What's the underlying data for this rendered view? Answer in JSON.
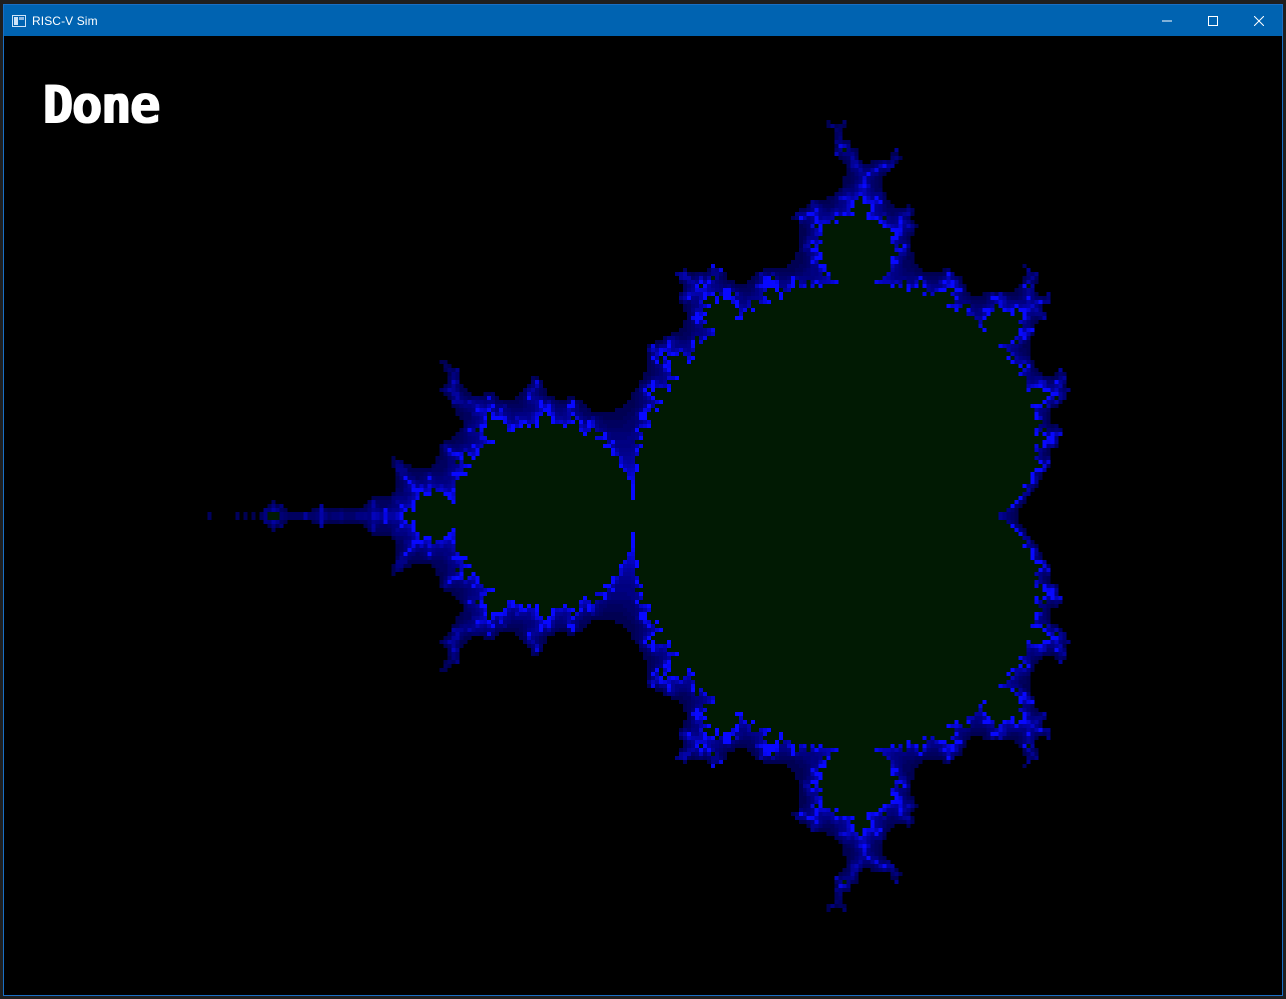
{
  "window": {
    "title": "RISC-V Sim",
    "app_icon": "window-app-icon",
    "controls": {
      "minimize_icon": "minimize-icon",
      "maximize_icon": "maximize-icon",
      "close_icon": "close-icon"
    }
  },
  "canvas": {
    "status_text": "Done",
    "image": "mandelbrot-set-render",
    "colors": {
      "background": "#000000",
      "set_fill": "#011a03",
      "boundary": "#1414ff",
      "titlebar": "#0063b1"
    }
  }
}
